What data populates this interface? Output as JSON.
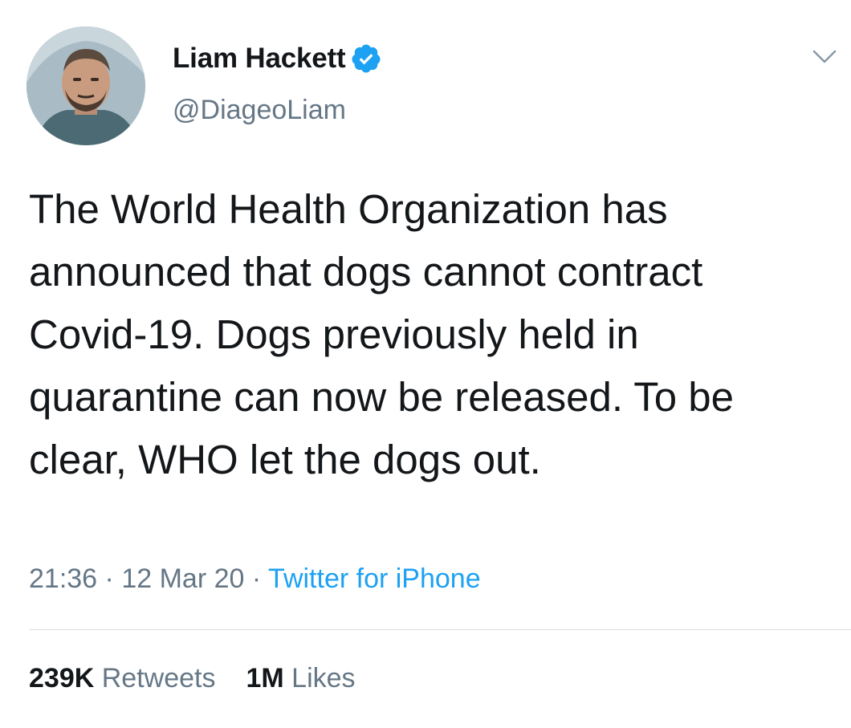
{
  "tweet": {
    "author": {
      "display_name": "Liam Hackett",
      "handle": "@DiageoLiam",
      "verified": true
    },
    "text": "The World Health Organization has announced that dogs cannot contract Covid-19. Dogs previously held in quarantine can now be released. To be clear, WHO let the dogs out.",
    "time": "21:36",
    "date": "12 Mar 20",
    "separator": "·",
    "source": "Twitter for iPhone",
    "stats": {
      "retweets_count": "239K",
      "retweets_label": "Retweets",
      "likes_count": "1M",
      "likes_label": "Likes"
    }
  },
  "icons": {
    "verified": "verified-badge-icon",
    "caret": "chevron-down-icon"
  },
  "colors": {
    "text": "#14171a",
    "secondary": "#657786",
    "accent": "#1da1f2",
    "divider": "#d8dee3"
  }
}
